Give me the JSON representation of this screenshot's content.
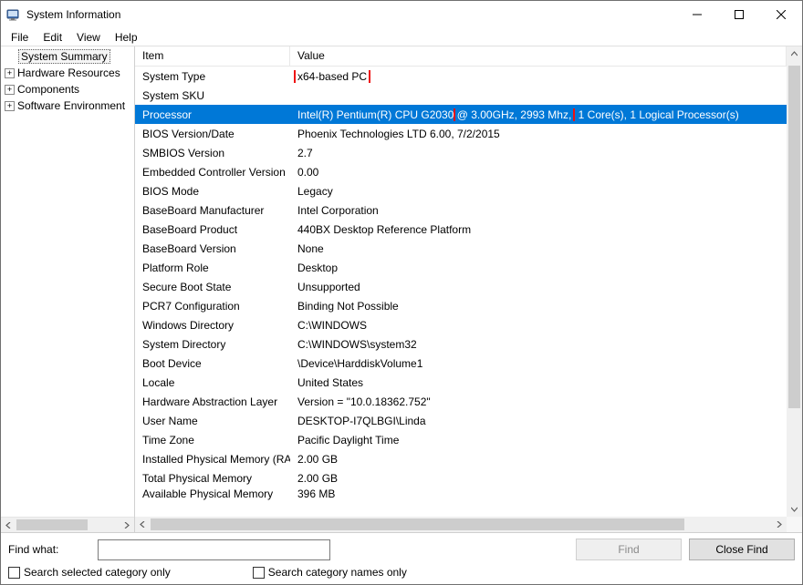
{
  "window": {
    "title": "System Information"
  },
  "menu": {
    "file": "File",
    "edit": "Edit",
    "view": "View",
    "help": "Help"
  },
  "tree": {
    "items": [
      {
        "label": "System Summary",
        "expandable": false,
        "selected": true
      },
      {
        "label": "Hardware Resources",
        "expandable": true
      },
      {
        "label": "Components",
        "expandable": true
      },
      {
        "label": "Software Environment",
        "expandable": true
      }
    ]
  },
  "list": {
    "headers": {
      "item": "Item",
      "value": "Value"
    },
    "rows": [
      {
        "item": "System Type",
        "value": "x64-based PC",
        "value_highlight": true
      },
      {
        "item": "System SKU",
        "value": ""
      },
      {
        "item": "Processor",
        "value": "Intel(R) Pentium(R) CPU G2030 @ 3.00GHz, 2993 Mhz, 1 Core(s), 1 Logical Processor(s)",
        "selected": true,
        "value_pre": "Intel(R) Pentium(R) CPU G2030 ",
        "value_hl": "@ 3.00GHz, 2993 Mhz,",
        "value_post": " 1 Core(s), 1 Logical Processor(s)"
      },
      {
        "item": "BIOS Version/Date",
        "value": "Phoenix Technologies LTD 6.00, 7/2/2015"
      },
      {
        "item": "SMBIOS Version",
        "value": "2.7"
      },
      {
        "item": "Embedded Controller Version",
        "value": "0.00"
      },
      {
        "item": "BIOS Mode",
        "value": "Legacy"
      },
      {
        "item": "BaseBoard Manufacturer",
        "value": "Intel Corporation"
      },
      {
        "item": "BaseBoard Product",
        "value": "440BX Desktop Reference Platform"
      },
      {
        "item": "BaseBoard Version",
        "value": "None"
      },
      {
        "item": "Platform Role",
        "value": "Desktop"
      },
      {
        "item": "Secure Boot State",
        "value": "Unsupported"
      },
      {
        "item": "PCR7 Configuration",
        "value": "Binding Not Possible"
      },
      {
        "item": "Windows Directory",
        "value": "C:\\WINDOWS"
      },
      {
        "item": "System Directory",
        "value": "C:\\WINDOWS\\system32"
      },
      {
        "item": "Boot Device",
        "value": "\\Device\\HarddiskVolume1"
      },
      {
        "item": "Locale",
        "value": "United States"
      },
      {
        "item": "Hardware Abstraction Layer",
        "value": "Version = \"10.0.18362.752\""
      },
      {
        "item": "User Name",
        "value": "DESKTOP-I7QLBGI\\Linda"
      },
      {
        "item": "Time Zone",
        "value": "Pacific Daylight Time"
      },
      {
        "item": "Installed Physical Memory (RAM)",
        "value": "2.00 GB"
      },
      {
        "item": "Total Physical Memory",
        "value": "2.00 GB"
      },
      {
        "item": "Available Physical Memory",
        "value": "396 MB",
        "partial": true
      }
    ]
  },
  "bottom": {
    "find_label": "Find what:",
    "find_button": "Find",
    "close_find_button": "Close Find",
    "chk_selected": "Search selected category only",
    "chk_names": "Search category names only"
  }
}
